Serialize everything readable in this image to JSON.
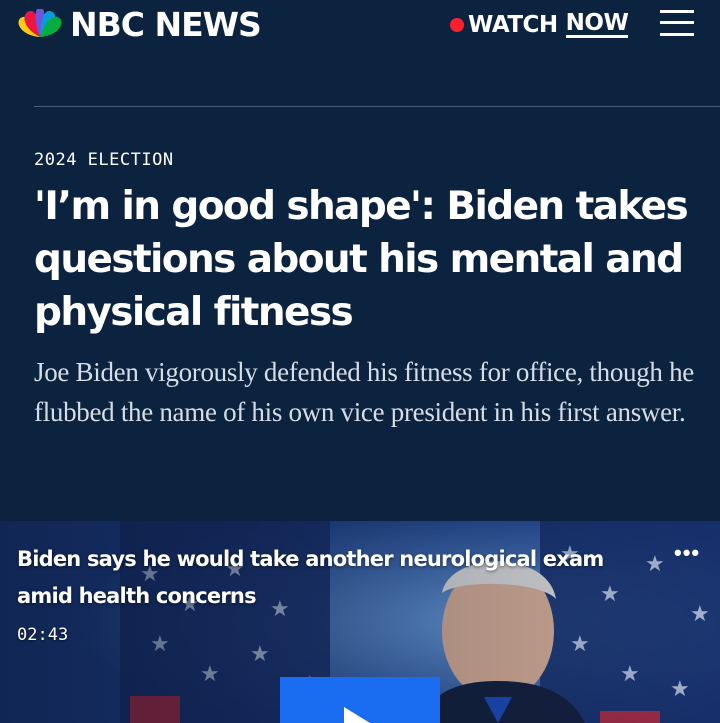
{
  "header": {
    "brand": "NBC NEWS",
    "watch_label": "WATCH",
    "now_label": "NOW",
    "colors": {
      "background": "#0c2340",
      "live_dot": "#ff1e2d"
    }
  },
  "article": {
    "eyebrow": "2024 ELECTION",
    "headline": "'I’m in good shape': Biden takes questions about his mental and physical fitness",
    "dek": "Joe Biden vigorously defended his fitness for office, though he flubbed the name of his own vice president in his first answer."
  },
  "video": {
    "title": "Biden says he would take another neurological exam amid health concerns",
    "duration": "02:43",
    "more_icon": "ellipsis-icon",
    "play_icon": "play-icon",
    "accent": "#1a6cf0"
  }
}
